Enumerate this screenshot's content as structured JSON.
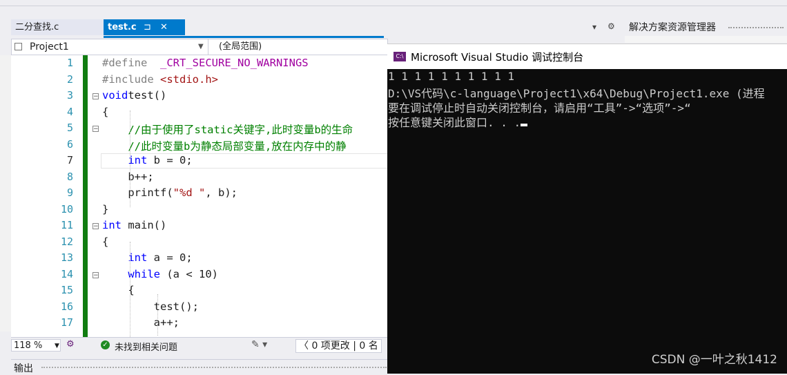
{
  "tabs": [
    {
      "label": "二分查找.c",
      "active": false
    },
    {
      "label": "test.c",
      "active": true,
      "pin": "⊐",
      "close": "✕"
    }
  ],
  "solution_explorer": {
    "title": "解决方案资源管理器"
  },
  "tab_controls": {
    "dropdown": "▾",
    "settings": "⚙"
  },
  "nav": {
    "project": "Project1",
    "scope": "(全局范围)"
  },
  "editor": {
    "line_numbers": [
      "1",
      "2",
      "3",
      "4",
      "5",
      "6",
      "7",
      "8",
      "9",
      "10",
      "11",
      "12",
      "13",
      "14",
      "15",
      "16",
      "17"
    ],
    "current_line": 7,
    "lines": [
      [
        [
          "pp",
          "#define  "
        ],
        [
          "mac",
          "_CRT_SECURE_NO_WARNINGS"
        ]
      ],
      [
        [
          "pp",
          "#include "
        ],
        [
          "str",
          "<stdio.h>"
        ]
      ],
      [
        [
          "kw",
          "void"
        ],
        [
          "",
          "test()"
        ]
      ],
      [
        [
          "",
          "{"
        ]
      ],
      [
        [
          "",
          "    "
        ],
        [
          "cmt",
          "//由于使用了static关键字,此时变量b的生命"
        ]
      ],
      [
        [
          "",
          "    "
        ],
        [
          "cmt",
          "//此时变量b为静态局部变量,放在内存中的静"
        ]
      ],
      [
        [
          "",
          "    "
        ],
        [
          "kw",
          "int"
        ],
        [
          "",
          " b = 0;"
        ]
      ],
      [
        [
          "",
          "    b++;"
        ]
      ],
      [
        [
          "",
          "    printf("
        ],
        [
          "str",
          "\"%d \""
        ],
        [
          "",
          ", b);"
        ]
      ],
      [
        [
          "",
          "}"
        ]
      ],
      [
        [
          "kw",
          "int"
        ],
        [
          "",
          " main()"
        ]
      ],
      [
        [
          "",
          "{"
        ]
      ],
      [
        [
          "",
          "    "
        ],
        [
          "kw",
          "int"
        ],
        [
          "",
          " a = 0;"
        ]
      ],
      [
        [
          "",
          "    "
        ],
        [
          "kw",
          "while"
        ],
        [
          "",
          " (a < 10)"
        ]
      ],
      [
        [
          "",
          "    {"
        ]
      ],
      [
        [
          "",
          "        test();"
        ]
      ],
      [
        [
          "",
          "        a++;"
        ]
      ]
    ]
  },
  "status": {
    "zoom": "118 %",
    "issues": "未找到相关问题",
    "changes": "〈 0 项更改 | 0 名"
  },
  "output": {
    "label": "输出"
  },
  "console": {
    "title": "Microsoft Visual Studio 调试控制台",
    "icon_text": "C:\\",
    "lines": [
      "1 1 1 1 1 1 1 1 1 1",
      "D:\\VS代码\\c-language\\Project1\\x64\\Debug\\Project1.exe (进程",
      "要在调试停止时自动关闭控制台，请启用“工具”->“选项”->“",
      "按任意键关闭此窗口. . ."
    ]
  },
  "watermark": "CSDN @一叶之秋1412",
  "colors": {
    "accent": "#007acc",
    "console_bg": "#0c0c0c",
    "changed_bar": "#107c10"
  }
}
